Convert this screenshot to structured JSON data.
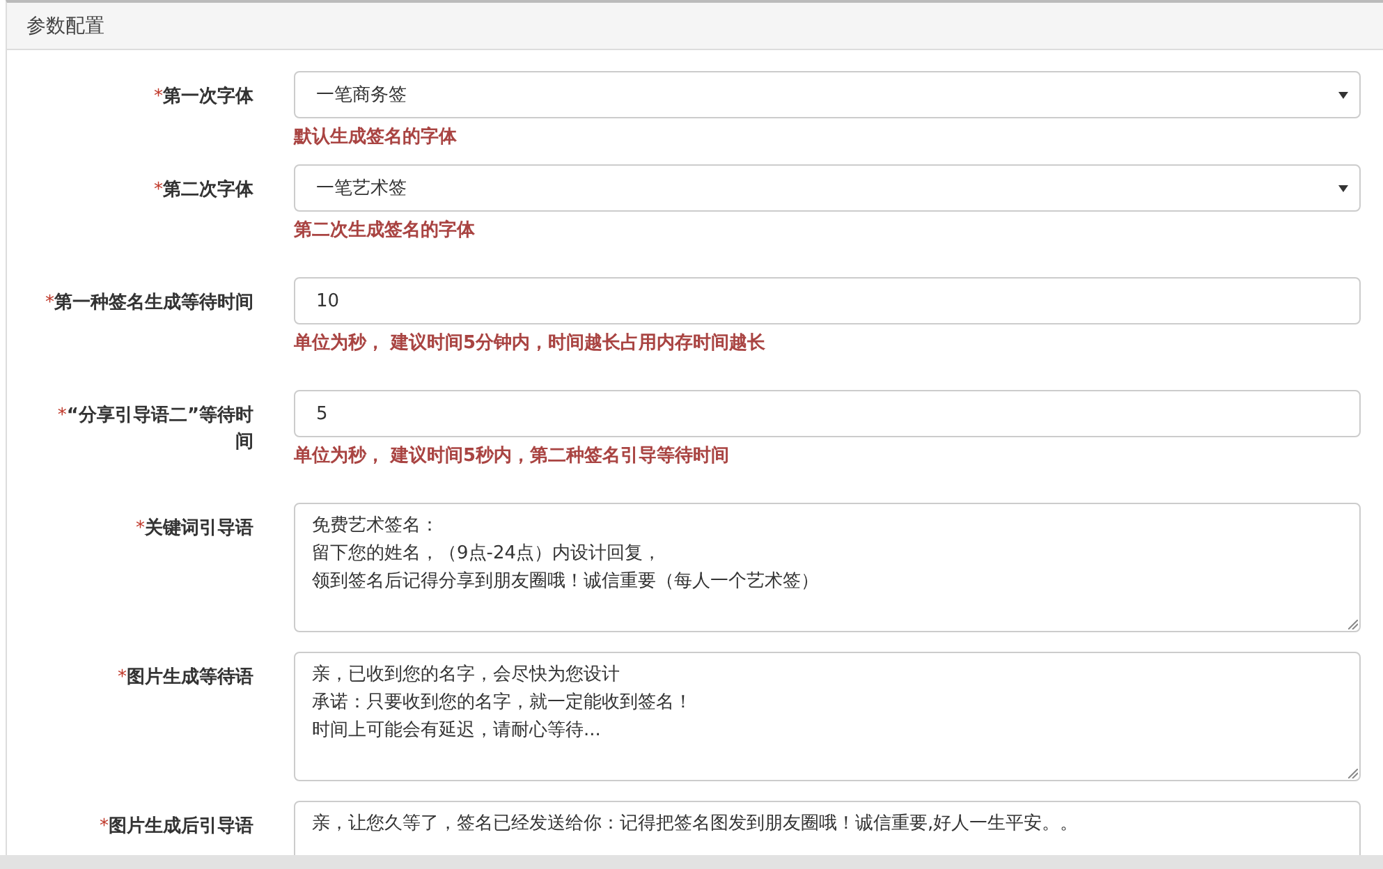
{
  "panel": {
    "title": "参数配置"
  },
  "fields": [
    {
      "kind": "select",
      "required_mark": "*",
      "label": "第一次字体",
      "value": "一笔商务签",
      "help": "默认生成签名的字体"
    },
    {
      "kind": "select",
      "required_mark": "*",
      "label": "第二次字体",
      "value": "一笔艺术签",
      "help": "第二次生成签名的字体"
    },
    {
      "kind": "input",
      "required_mark": "*",
      "label": "第一种签名生成等待时间",
      "value": "10",
      "help": "单位为秒， 建议时间5分钟内，时间越长占用内存时间越长"
    },
    {
      "kind": "input",
      "required_mark": "*",
      "label": "“分享引导语二”等待时间",
      "value": "5",
      "help": "单位为秒， 建议时间5秒内，第二种签名引导等待时间"
    },
    {
      "kind": "textarea",
      "required_mark": "*",
      "label": "关键词引导语",
      "resizable": true,
      "lines": [
        "免费艺术签名：",
        "留下您的姓名，（9点-24点）内设计回复，",
        "领到签名后记得分享到朋友圈哦！诚信重要（每人一个艺术签）"
      ]
    },
    {
      "kind": "textarea",
      "required_mark": "*",
      "label": "图片生成等待语",
      "resizable": true,
      "lines": [
        "亲，已收到您的名字，会尽快为您设计",
        "承诺：只要收到您的名字，就一定能收到签名！",
        "时间上可能会有延迟，请耐心等待..."
      ]
    },
    {
      "kind": "textarea",
      "required_mark": "*",
      "label": "图片生成后引导语",
      "lines": [
        "亲，让您久等了，签名已经发送给你：记得把签名图发到朋友圈哦！诚信重要,好人一生平安。。"
      ]
    }
  ]
}
